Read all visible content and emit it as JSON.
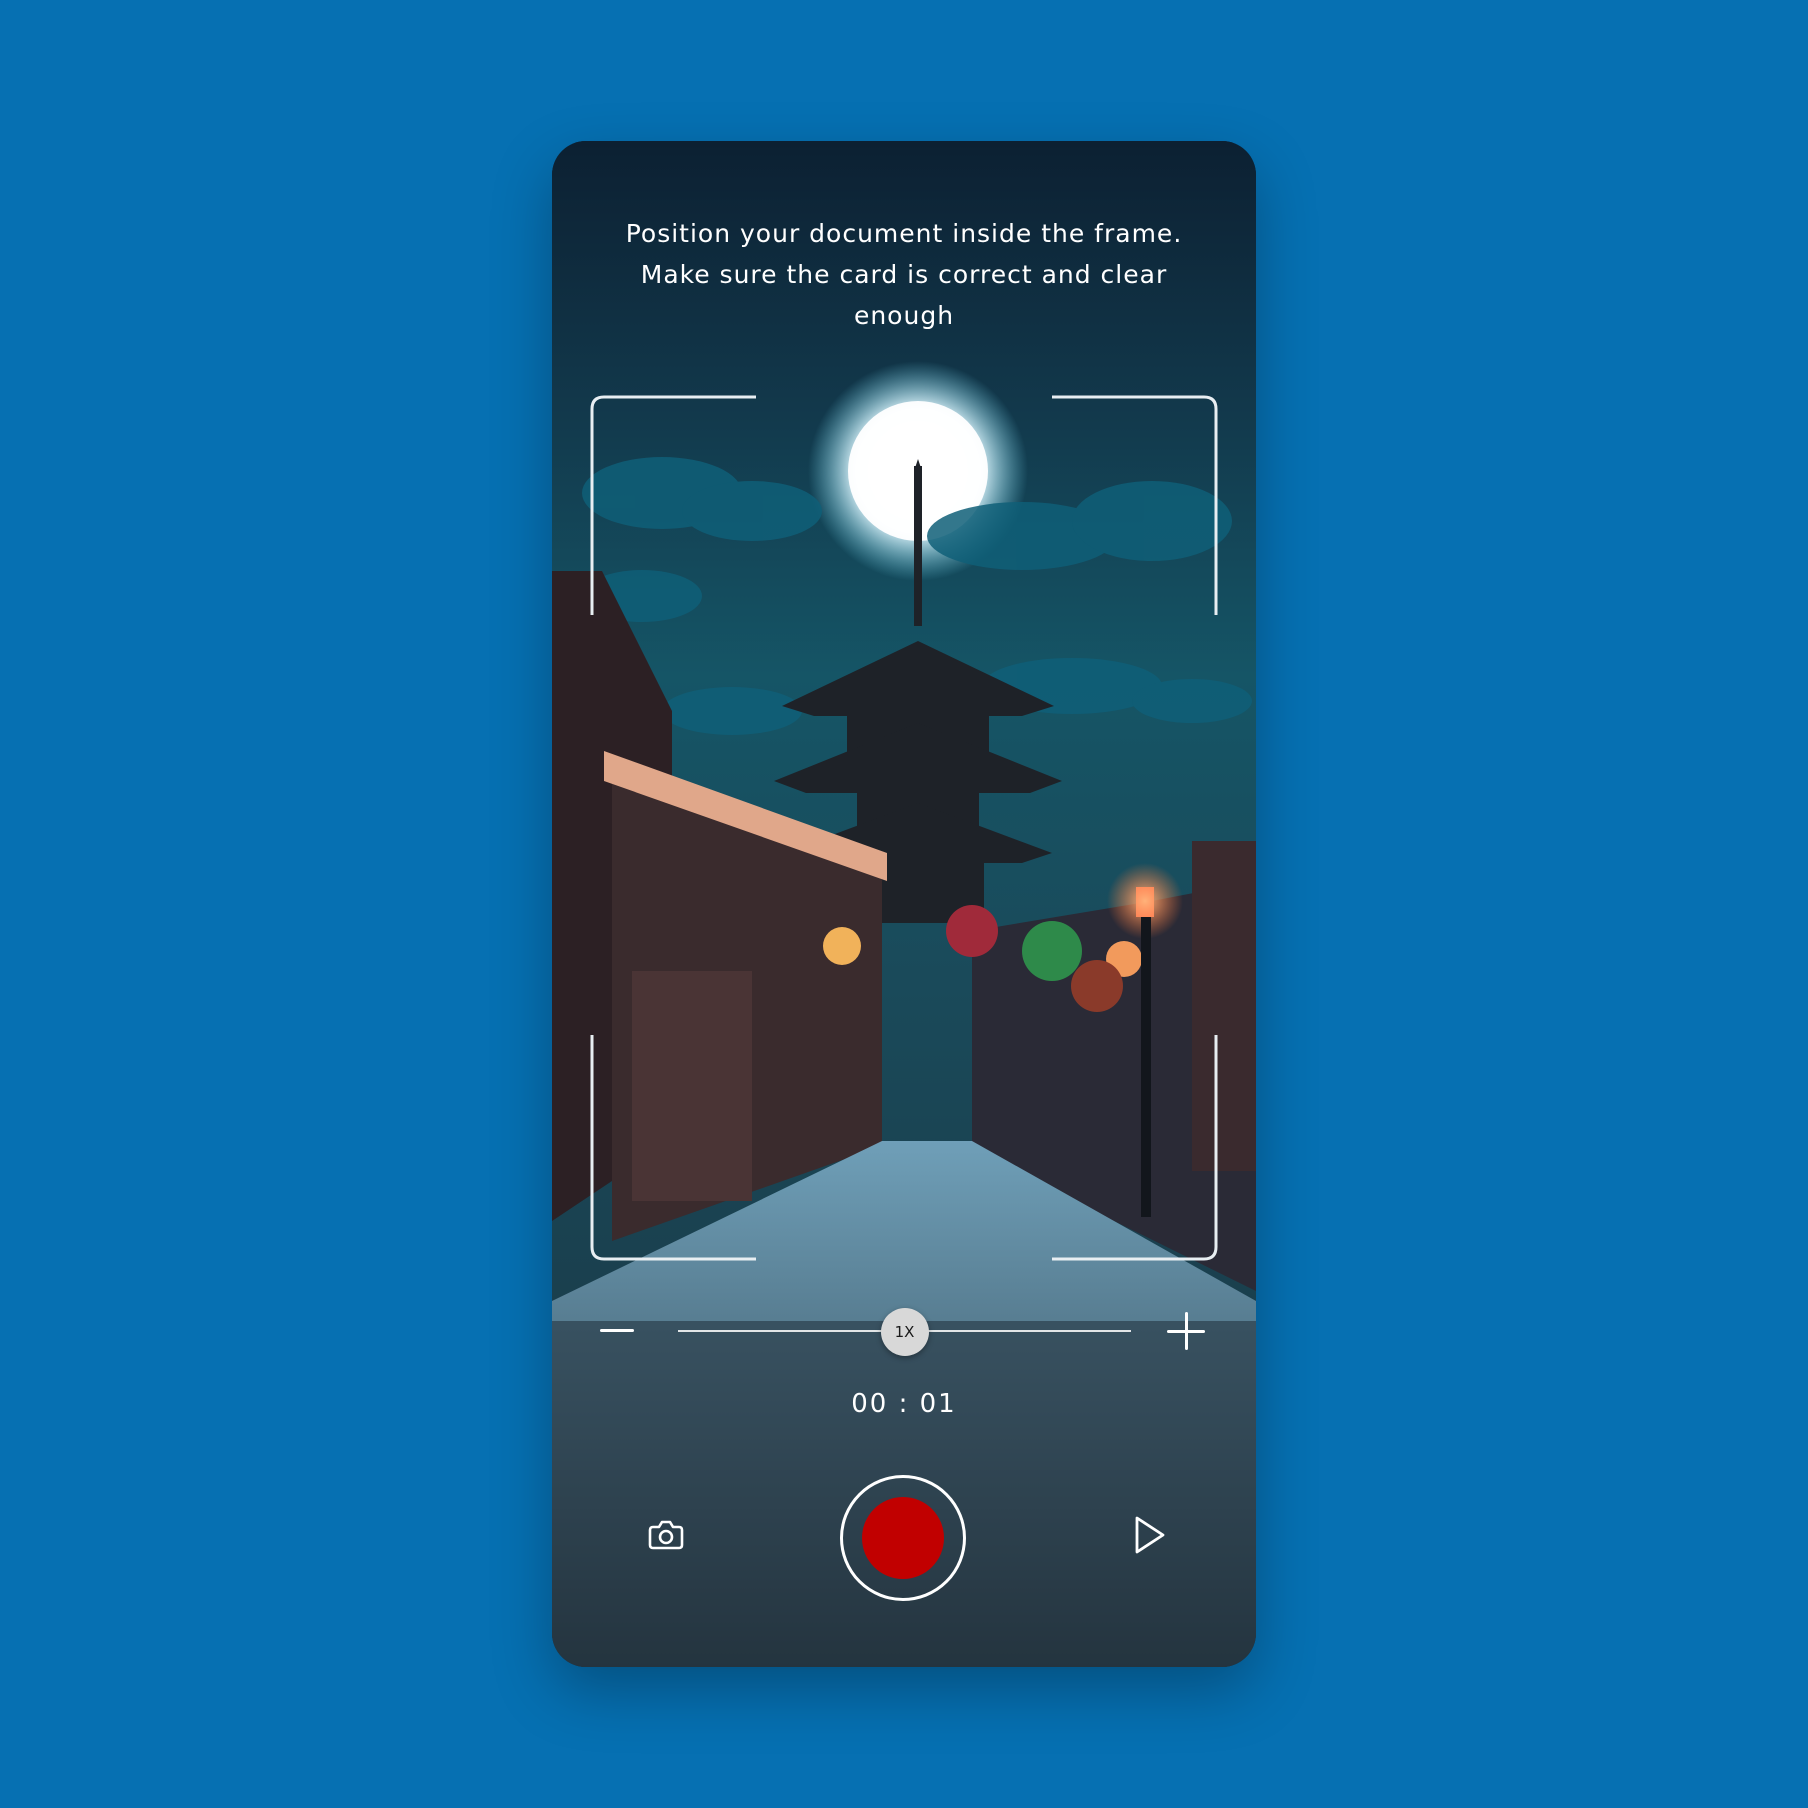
{
  "instruction": {
    "line1": "Position your document inside the frame.",
    "line2": "Make sure the card is correct and clear",
    "line3": "enough"
  },
  "zoom": {
    "level_label": "1X",
    "level_fraction": 0.5
  },
  "recording": {
    "timer": "00 : 01"
  },
  "controls": {
    "camera_icon": "camera-icon",
    "play_icon": "play-icon",
    "zoom_out_icon": "minus-icon",
    "zoom_in_icon": "plus-icon"
  },
  "colors": {
    "page_background": "#0670b2",
    "record_button": "#c10000",
    "frame_border": "#e8eef2"
  }
}
